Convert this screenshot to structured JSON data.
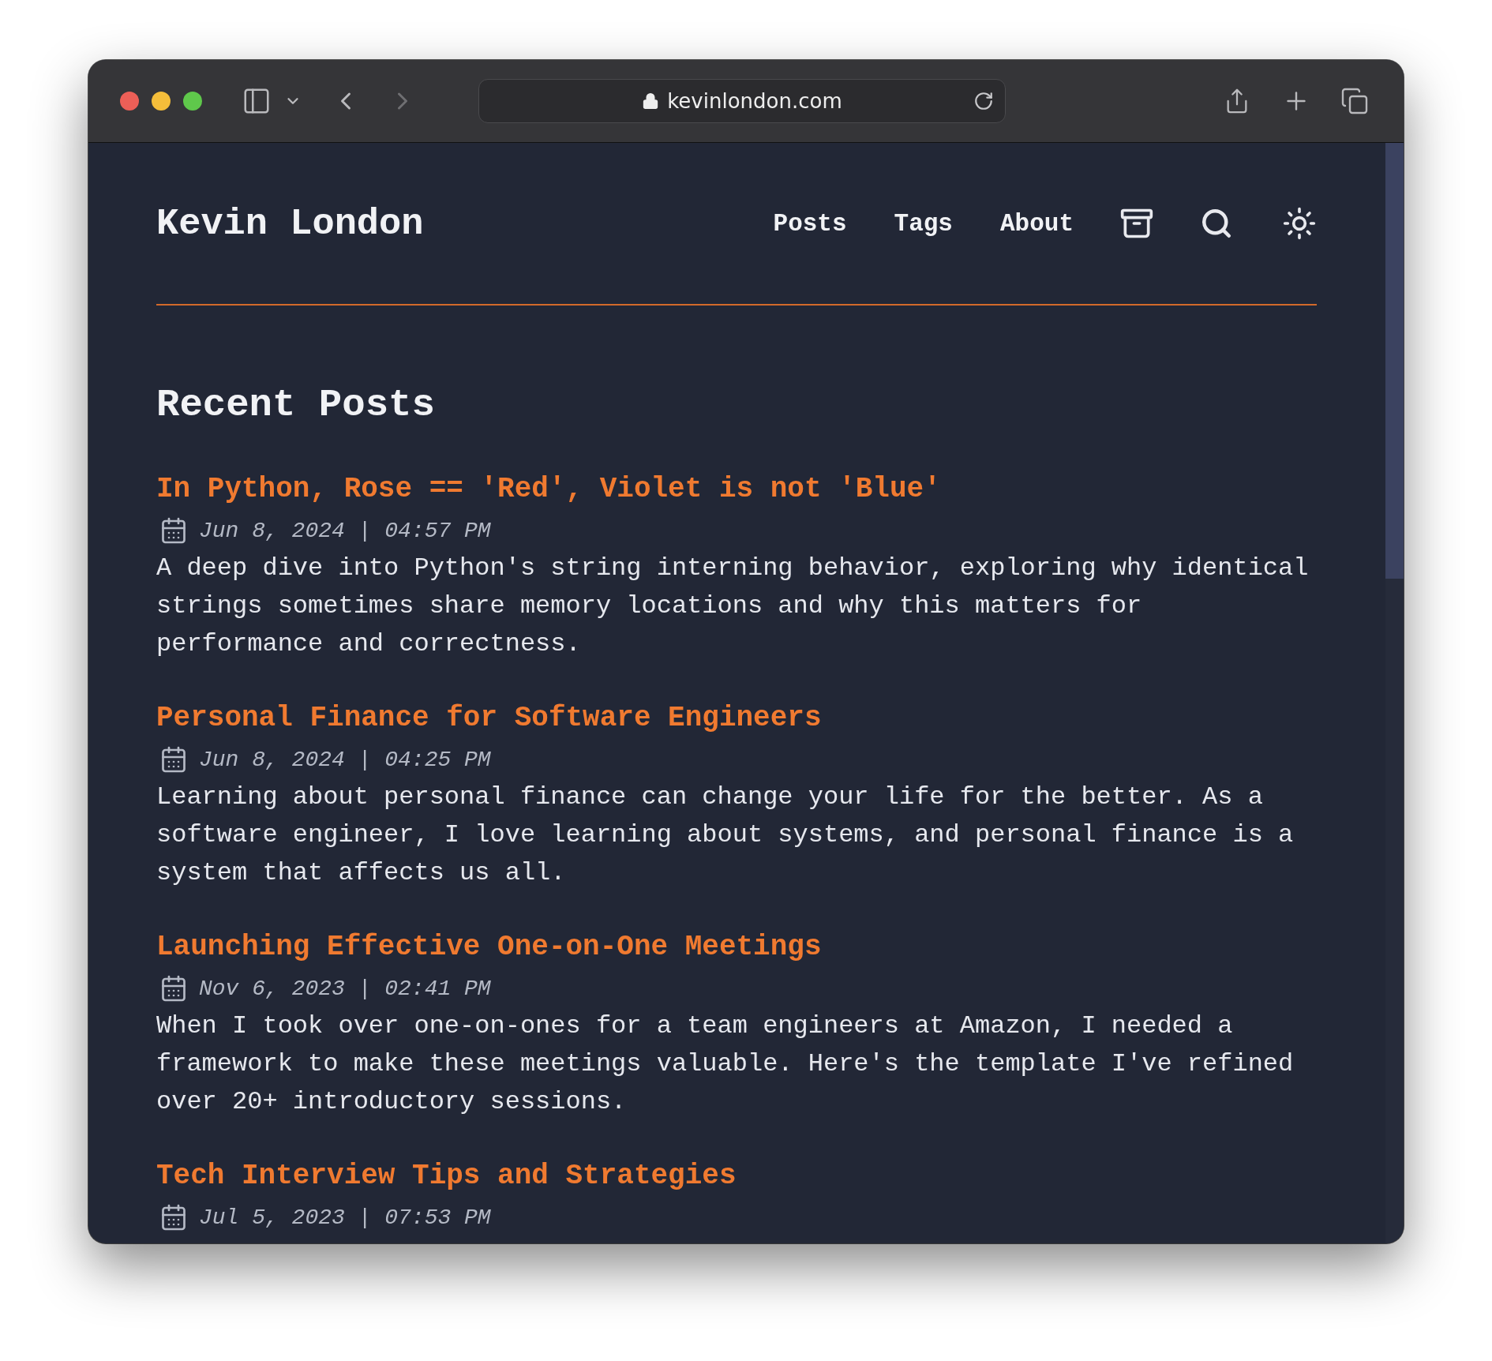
{
  "browser": {
    "url": "kevinlondon.com"
  },
  "site": {
    "title": "Kevin London",
    "nav": [
      {
        "label": "Posts"
      },
      {
        "label": "Tags"
      },
      {
        "label": "About"
      }
    ]
  },
  "heading": "Recent Posts",
  "posts": [
    {
      "title": "In Python, Rose == 'Red', Violet is not 'Blue'",
      "date": "Jun 8, 2024 | 04:57 PM",
      "summary": "A deep dive into Python's string interning behavior, exploring why identical strings sometimes share memory locations and why this matters for performance and correctness."
    },
    {
      "title": "Personal Finance for Software Engineers",
      "date": "Jun 8, 2024 | 04:25 PM",
      "summary": "Learning about personal finance can change your life for the better. As a software engineer, I love learning about systems, and personal finance is a system that affects us all."
    },
    {
      "title": "Launching Effective One-on-One Meetings",
      "date": "Nov 6, 2023 | 02:41 PM",
      "summary": "When I took over one-on-ones for a team engineers at Amazon, I needed a framework to make these meetings valuable. Here's the template I've refined over 20+ introductory sessions."
    },
    {
      "title": "Tech Interview Tips and Strategies",
      "date": "Jul 5, 2023 | 07:53 PM"
    }
  ]
}
